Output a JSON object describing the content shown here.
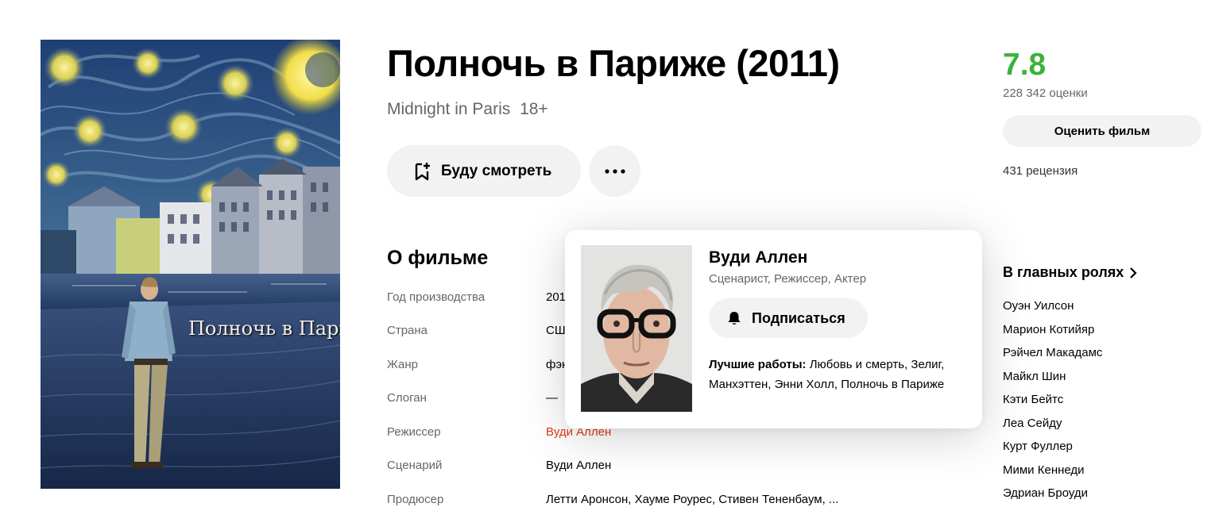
{
  "poster": {
    "overlay_text": "Полночь в Париже"
  },
  "movie": {
    "title": "Полночь в Париже (2011)",
    "original_title": "Midnight in Paris",
    "age_rating": "18+"
  },
  "actions": {
    "watch_label": "Буду смотреть",
    "more_icon": "more-dots-icon"
  },
  "about": {
    "heading": "О фильме",
    "rows": [
      {
        "label": "Год производства",
        "value": "201"
      },
      {
        "label": "Страна",
        "value": "СШ"
      },
      {
        "label": "Жанр",
        "value": "фэн"
      },
      {
        "label": "Слоган",
        "value": "—"
      },
      {
        "label": "Режиссер",
        "value": "Вуди Аллен"
      },
      {
        "label": "Сценарий",
        "value": "Вуди Аллен"
      },
      {
        "label": "Продюсер",
        "value": "Летти Аронсон, Хауме Роурес, Стивен Тененбаум, ..."
      }
    ]
  },
  "rating": {
    "score": "7.8",
    "votes": "228 342 оценки",
    "rate_button": "Оценить фильм",
    "reviews": "431 рецензия",
    "score_color": "#3bb33b"
  },
  "cast": {
    "heading": "В главных ролях",
    "items": [
      "Оуэн Уилсон",
      "Марион Котийяр",
      "Рэйчел Макадамс",
      "Майкл Шин",
      "Кэти Бейтс",
      "Леа Сейду",
      "Курт Фуллер",
      "Мими Кеннеди",
      "Эдриан Броуди"
    ]
  },
  "popup": {
    "name": "Вуди Аллен",
    "roles": "Сценарист, Режиссер, Актер",
    "subscribe_label": "Подписаться",
    "best_label": "Лучшие работы:",
    "best_works": "Любовь и смерть, Зелиг, Манхэттен, Энни Холл, Полночь в Париже"
  },
  "colors": {
    "accent_red": "#dc3c11",
    "button_bg": "#f2f2f2"
  }
}
